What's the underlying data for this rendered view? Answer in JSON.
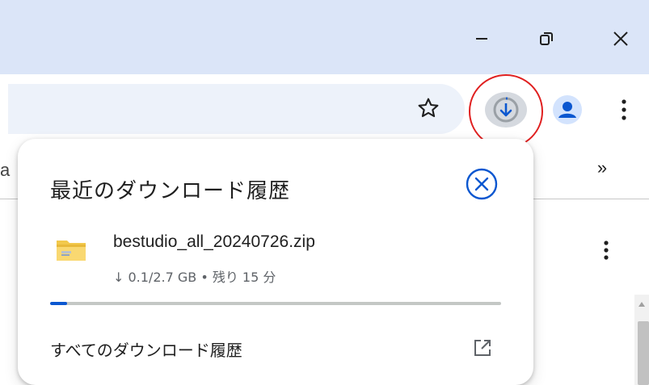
{
  "window": {
    "minimize_icon": "minimize-icon",
    "restore_icon": "restore-icon",
    "close_icon": "close-icon"
  },
  "toolbar": {
    "bookmark_icon": "star-icon",
    "download_icon": "download-icon",
    "profile_icon": "person-icon",
    "menu_icon": "more-vertical-icon",
    "overflow_label": "»"
  },
  "downloads_panel": {
    "title": "最近のダウンロード履歴",
    "close_icon": "close-circle-icon",
    "items": [
      {
        "file_name": "bestudio_all_20240726.zip",
        "status": "↓ 0.1/2.7 GB • 残り 15 分",
        "progress": 0.037,
        "icon": "folder-zip-icon"
      }
    ],
    "all_history_label": "すべてのダウンロード履歴",
    "open_icon": "open-in-new-icon"
  },
  "colors": {
    "titlebar": "#dbe5f8",
    "omnibox": "#edf2fa",
    "accent": "#0b57d0",
    "highlight_ring": "#e02020"
  }
}
